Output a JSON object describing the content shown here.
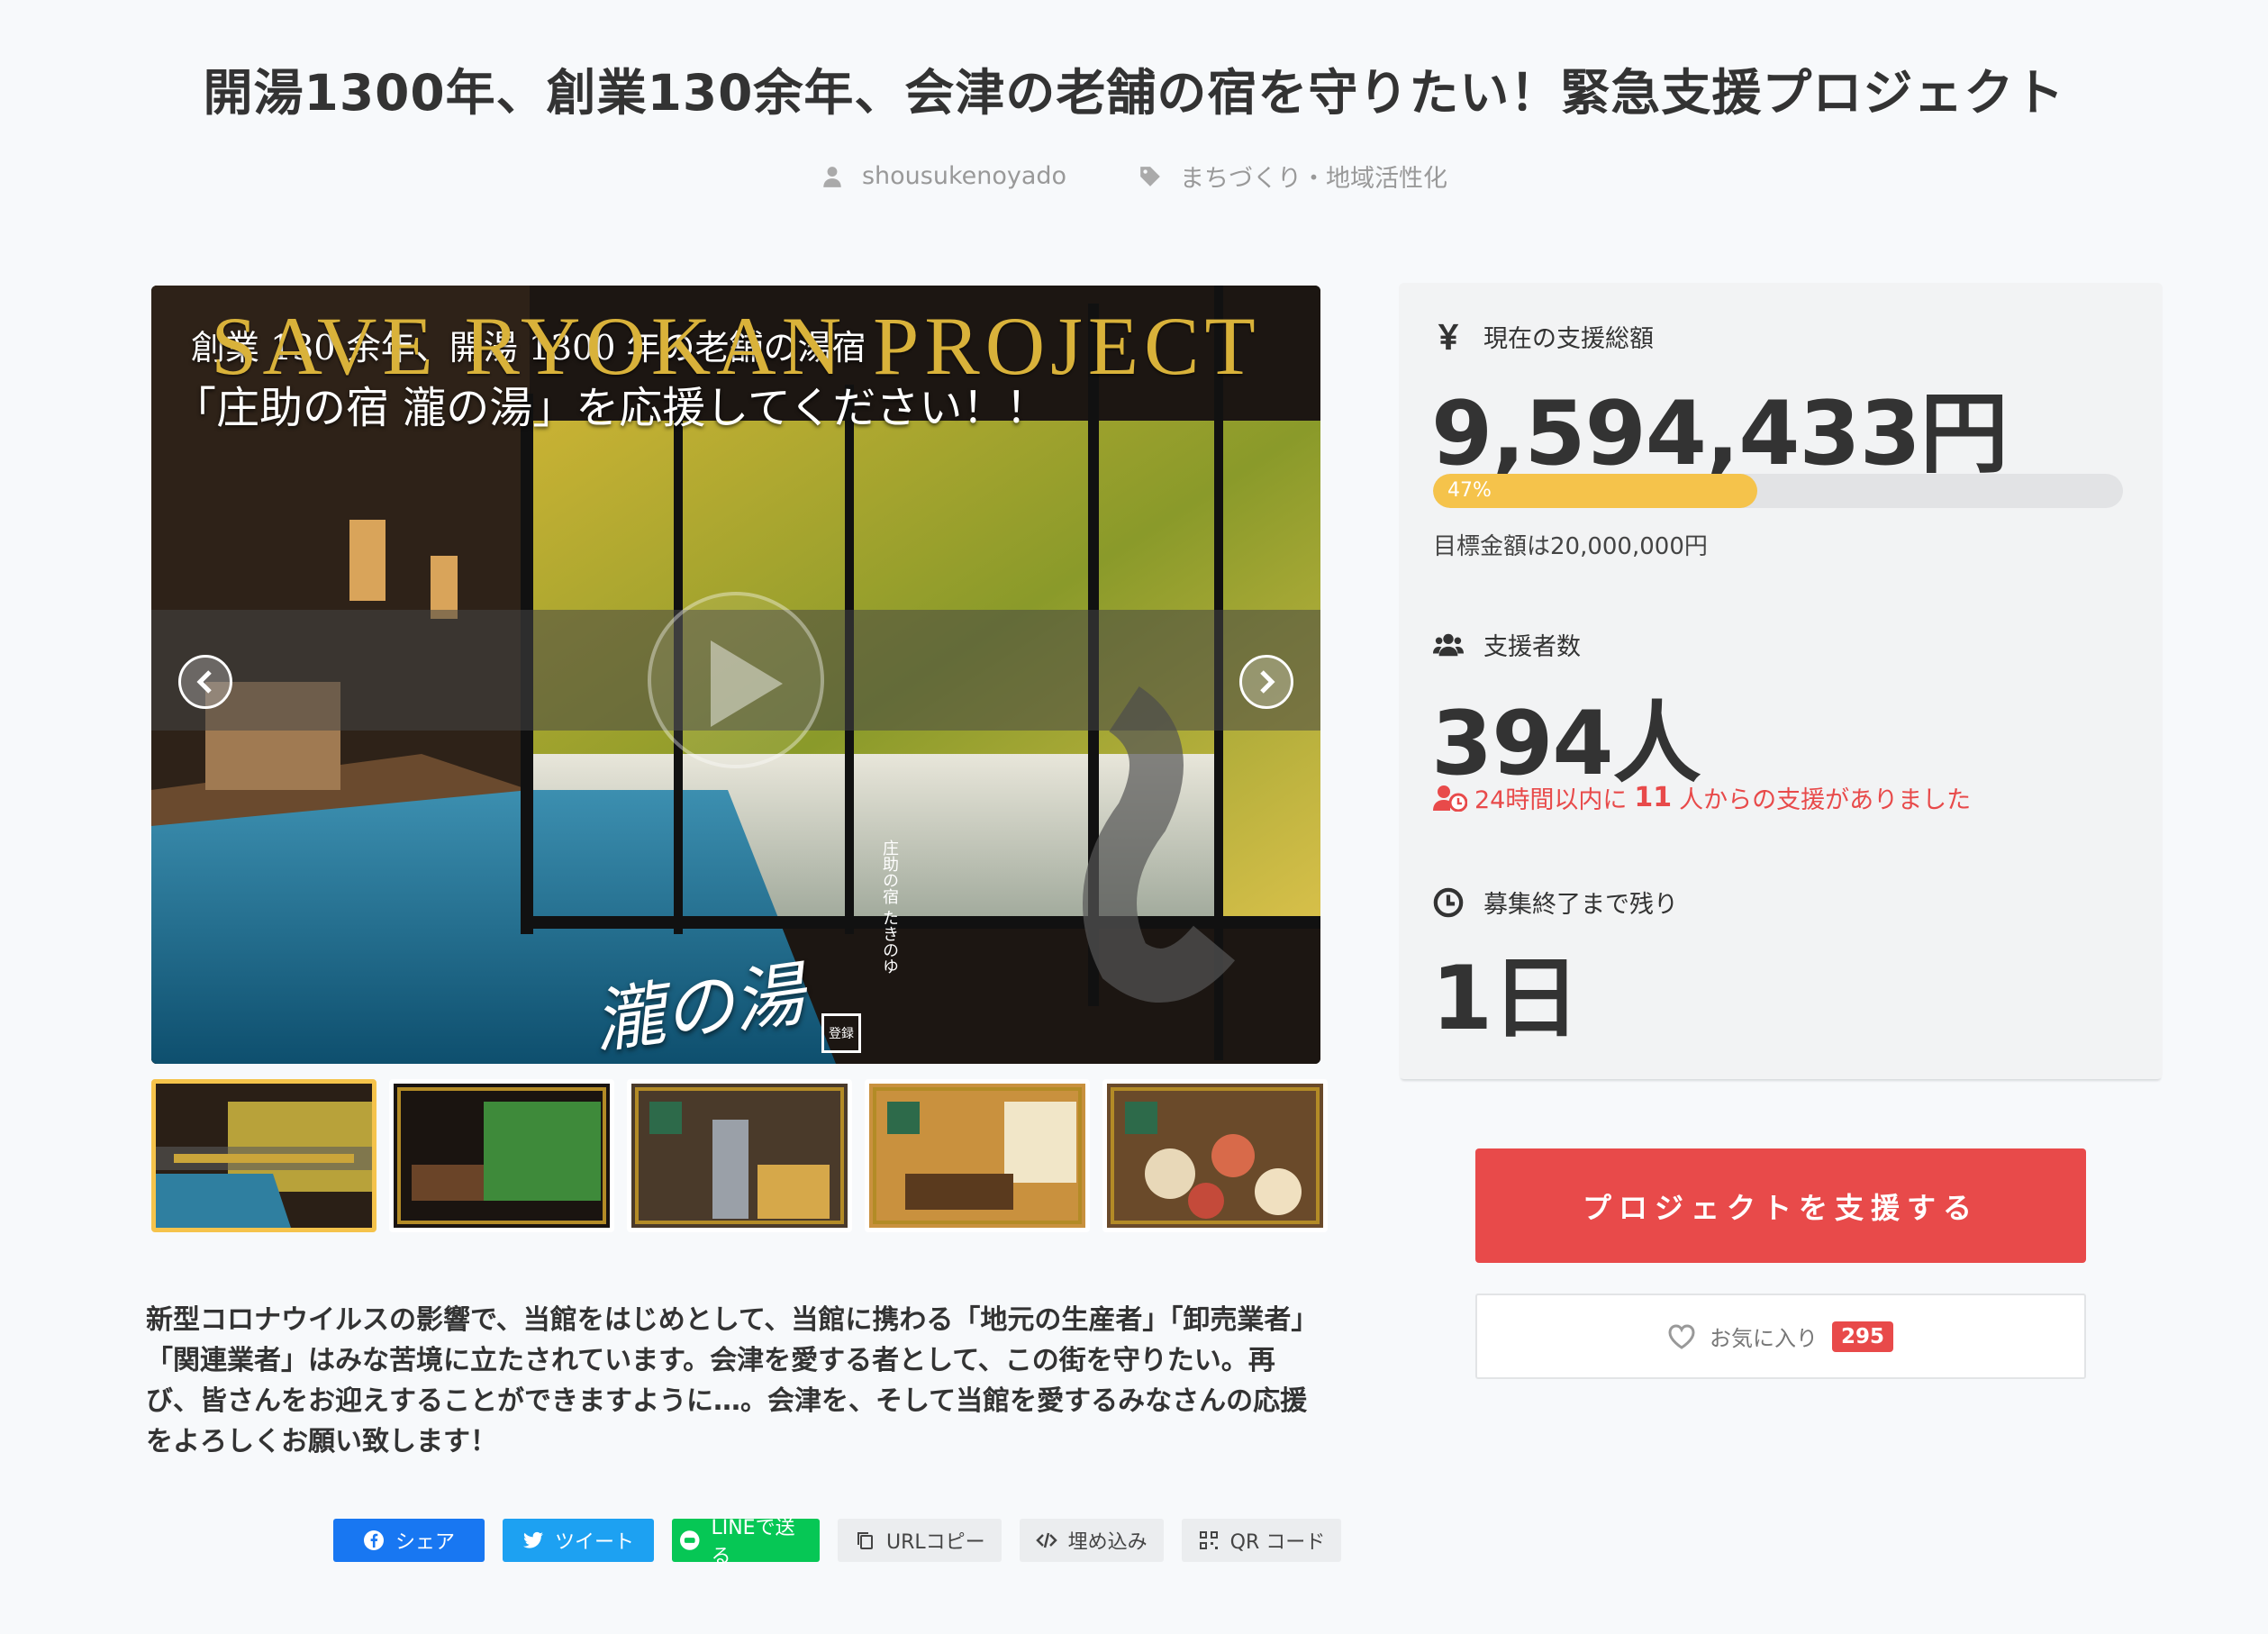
{
  "project": {
    "title": "開湯1300年、創業130余年、会津の老舗の宿を守りたい！緊急支援プロジェクト",
    "author": "shousukenoyado",
    "category": "まちづくり・地域活性化"
  },
  "media": {
    "overlay_line1": "創業 130 余年、開湯 1300 年の老舗の湯宿",
    "overlay_line2": "「庄助の宿 瀧の湯」を応援してください！！",
    "banner_text": "SAVE RYOKAN PROJECT",
    "vertical_caption": "庄助の宿 たきのゆ",
    "brand_logo": "瀧の湯",
    "stamp": "登録",
    "thumbnail_count": 5,
    "active_thumbnail": 0
  },
  "description": "新型コロナウイルスの影響で、当館をはじめとして、当館に携わる「地元の生産者」「卸売業者」「関連業者」はみな苦境に立たされています。会津を愛する者として、この街を守りたい。再び、皆さんをお迎えすることができますように…。会津を、そして当館を愛するみなさんの応援をよろしくお願い致します！",
  "share": {
    "facebook": "シェア",
    "twitter": "ツイート",
    "line": "LINEで送る",
    "url_copy": "URLコピー",
    "embed": "埋め込み",
    "qr": "QR コード"
  },
  "stats": {
    "total_label": "現在の支援総額",
    "total_amount": "9,594,433円",
    "progress_percent": 47,
    "progress_label": "47%",
    "goal_text": "目標金額は20,000,000円",
    "backers_label": "支援者数",
    "backers_count": "394人",
    "recent_prefix": "24時間以内に",
    "recent_count": "11",
    "recent_suffix": "人からの支援がありました",
    "remaining_label": "募集終了まで残り",
    "remaining_value": "1日"
  },
  "actions": {
    "support_button": "プロジェクトを支援する",
    "favorite_label": "お気に入り",
    "favorite_count": "295"
  },
  "colors": {
    "accent_red": "#e84a4a",
    "progress_yellow": "#f5c34b",
    "facebook_blue": "#1877f2",
    "twitter_blue": "#1da1f2",
    "line_green": "#06c755"
  }
}
